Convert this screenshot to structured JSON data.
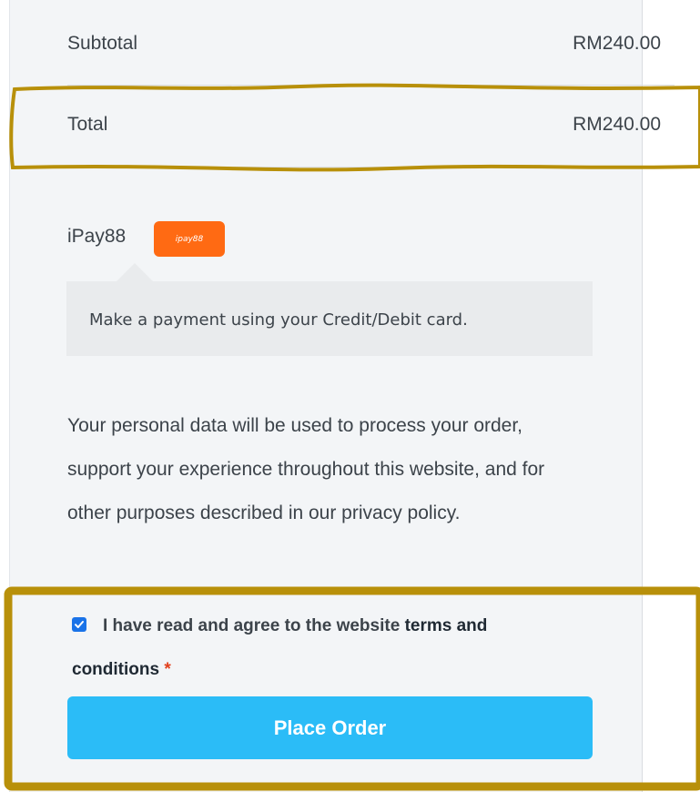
{
  "order_summary": {
    "subtotal_label": "Subtotal",
    "subtotal_value": "RM240.00",
    "total_label": "Total",
    "total_value": "RM240.00"
  },
  "payment": {
    "method_name": "iPay88",
    "logo_text": "ipay88",
    "description": "Make a payment using your Credit/Debit card."
  },
  "privacy": {
    "text": "Your personal data will be used to process your order, support your experience throughout this website, and for other purposes described in our privacy policy."
  },
  "terms": {
    "checked": true,
    "prefix": "I have read and agree to the website",
    "link_part1": "terms and",
    "link_part2": "conditions",
    "required_mark": "*"
  },
  "place_order": {
    "label": "Place Order"
  },
  "colors": {
    "accent": "#2bbcf7",
    "logo": "#ff6a13",
    "annotation": "#b8900a",
    "required": "#e2401c"
  }
}
